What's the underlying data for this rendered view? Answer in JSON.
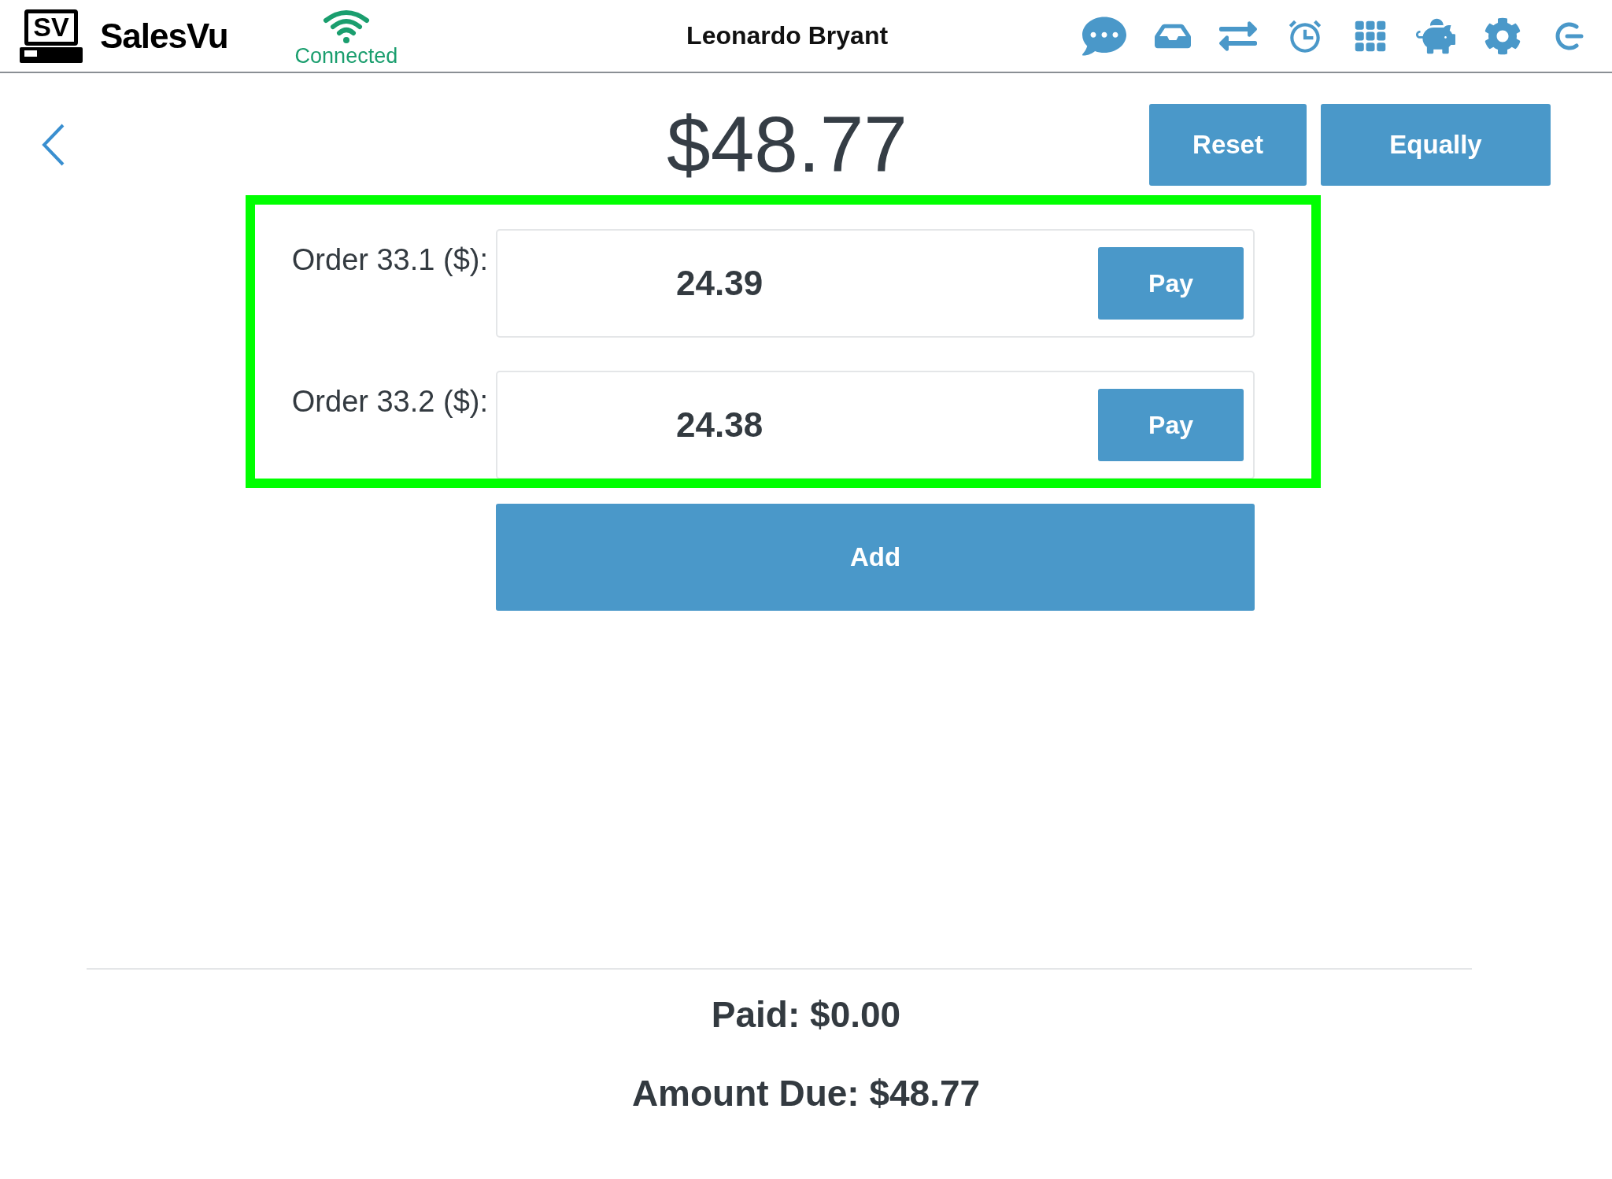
{
  "header": {
    "logo_mark": "SV",
    "brand": "SalesVu",
    "connection": "Connected",
    "user": "Leonardo Bryant"
  },
  "total": "$48.77",
  "actions": [
    "Reset",
    "Equally"
  ],
  "orders": [
    {
      "label": "Order 33.1 ($):",
      "amount": "24.39",
      "button": "Pay"
    },
    {
      "label": "Order 33.2 ($):",
      "amount": "24.38",
      "button": "Pay"
    }
  ],
  "add_button": "Add",
  "paid": "Paid: $0.00",
  "amount_due": "Amount Due: $48.77"
}
